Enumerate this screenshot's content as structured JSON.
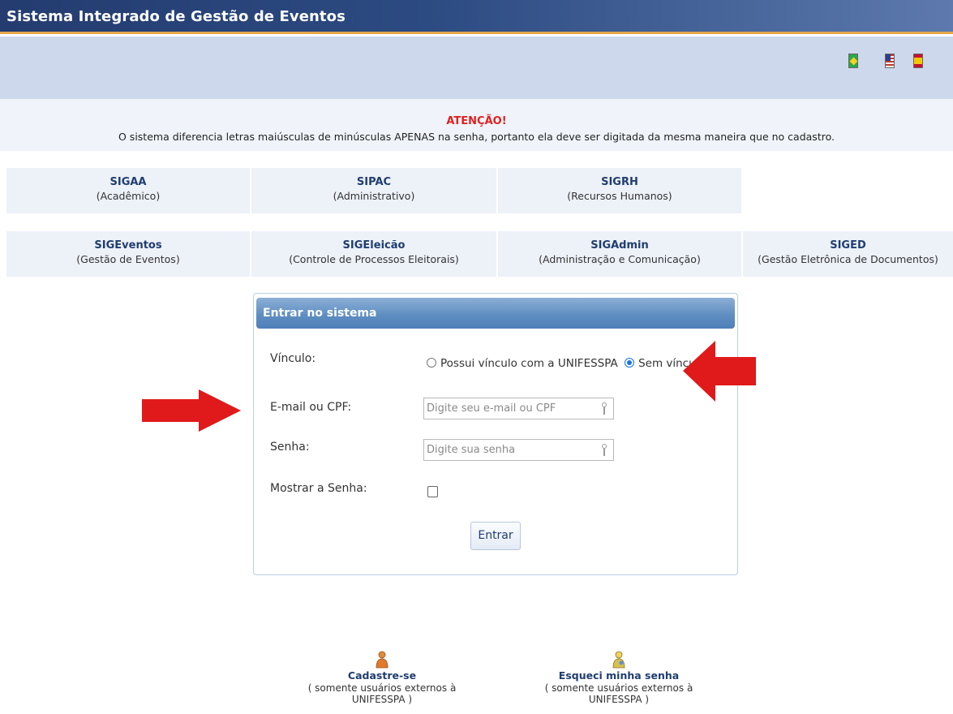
{
  "header": {
    "app_title": "Sistema Integrado de Gestão de Eventos"
  },
  "languages": [
    {
      "name": "brazil-flag-icon"
    },
    {
      "name": "us-flag-icon"
    },
    {
      "name": "spain-flag-icon"
    }
  ],
  "attention": {
    "title": "ATENÇÃO!",
    "message": "O sistema diferencia letras maiúsculas de minúsculas APENAS na senha, portanto ela deve ser digitada da mesma maneira que no cadastro."
  },
  "systems_row1": [
    {
      "name": "SIGAA",
      "desc": "(Acadêmico)"
    },
    {
      "name": "SIPAC",
      "desc": "(Administrativo)"
    },
    {
      "name": "SIGRH",
      "desc": "(Recursos Humanos)"
    }
  ],
  "systems_row2": [
    {
      "name": "SIGEventos",
      "desc": "(Gestão de Eventos)"
    },
    {
      "name": "SIGEleicão",
      "desc": "(Controle de Processos Eleitorais)"
    },
    {
      "name": "SIGAdmin",
      "desc": "(Administração e Comunicação)"
    },
    {
      "name": "SIGED",
      "desc": "(Gestão Eletrônica de Documentos)"
    }
  ],
  "login": {
    "title": "Entrar no sistema",
    "vinculo_label": "Vínculo:",
    "vinculo_options": [
      {
        "label": "Possui vínculo com a UNIFESSPA",
        "selected": false
      },
      {
        "label": "Sem vínculo",
        "selected": true
      }
    ],
    "email_label": "E-mail ou CPF:",
    "email_placeholder": "Digite seu e-mail ou CPF",
    "email_value": "",
    "password_label": "Senha:",
    "password_placeholder": "Digite sua senha",
    "password_value": "",
    "show_password_label": "Mostrar a Senha:",
    "show_password_checked": false,
    "submit_label": "Entrar"
  },
  "annotations": {
    "arrow_color": "#e0191b"
  },
  "bottom_links": [
    {
      "title": "Cadastre-se",
      "subtitle": "( somente usuários externos à UNIFESSPA )",
      "icon": "user-icon"
    },
    {
      "title": "Esqueci minha senha",
      "subtitle": "( somente usuários externos à UNIFESSPA )",
      "icon": "user-key-icon"
    }
  ],
  "colors": {
    "header_bg": "#2c4b82",
    "header_accent": "#e3a74a",
    "flagbar_bg": "#cdd8ec",
    "link_blue": "#1f3d70",
    "attention_red": "#e02020"
  }
}
